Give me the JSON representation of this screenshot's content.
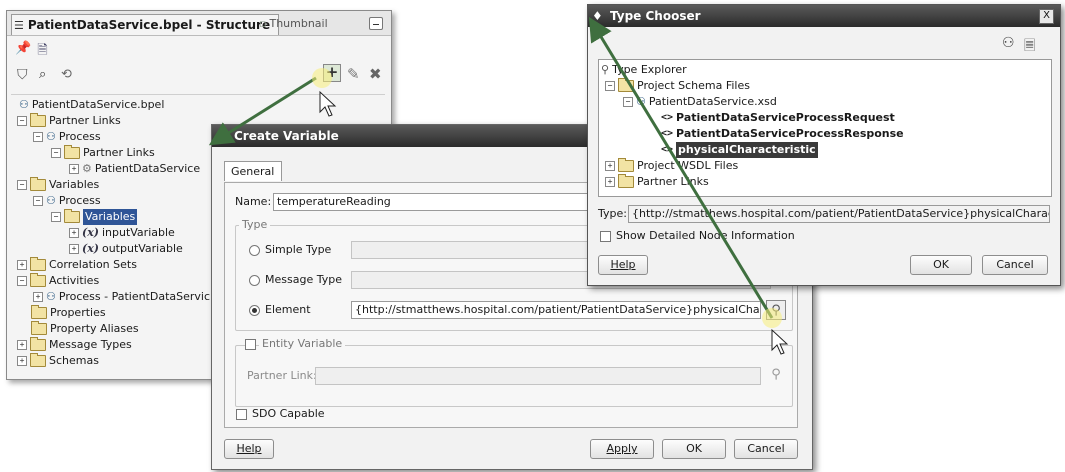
{
  "structure_panel": {
    "tab_active": "PatientDataService.bpel - Structure",
    "tab_inactive": "Thumbnail",
    "tree": [
      {
        "label": "PatientDataService.bpel"
      },
      {
        "label": "Partner Links"
      },
      {
        "label": "Process"
      },
      {
        "label": "Partner Links"
      },
      {
        "label": "PatientDataService"
      },
      {
        "label": "Variables"
      },
      {
        "label": "Process"
      },
      {
        "label": "Variables"
      },
      {
        "label": "inputVariable"
      },
      {
        "label": "outputVariable"
      },
      {
        "label": "Correlation Sets"
      },
      {
        "label": "Activities"
      },
      {
        "label": "Process - PatientDataServic"
      },
      {
        "label": "Properties"
      },
      {
        "label": "Property Aliases"
      },
      {
        "label": "Message Types"
      },
      {
        "label": "Schemas"
      }
    ],
    "var_prefix": "(x)"
  },
  "create_variable": {
    "title": "Create Variable",
    "tab": "General",
    "name_label": "Name:",
    "name_value": "temperatureReading",
    "type_group": "Type",
    "simple_type": "Simple Type",
    "message_type": "Message Type",
    "element": "Element",
    "element_value": "{http://stmatthews.hospital.com/patient/PatientDataService}physicalCharacteristic",
    "entity_variable": "Entity Variable",
    "partner_link_label": "Partner Link:",
    "sdo_capable": "SDO Capable",
    "help": "Help",
    "apply": "Apply",
    "ok": "OK",
    "cancel": "Cancel"
  },
  "type_chooser": {
    "title": "Type Chooser",
    "close": "X",
    "tree": [
      {
        "label": "Type Explorer"
      },
      {
        "label": "Project Schema Files"
      },
      {
        "label": "PatientDataService.xsd"
      },
      {
        "label": "PatientDataServiceProcessRequest"
      },
      {
        "label": "PatientDataServiceProcessResponse"
      },
      {
        "label": "physicalCharacteristic"
      },
      {
        "label": "Project WSDL Files"
      },
      {
        "label": "Partner Links"
      }
    ],
    "type_label": "Type:",
    "type_value": "{http://stmatthews.hospital.com/patient/PatientDataService}physicalCharacteristic",
    "show_detailed": "Show Detailed Node Information",
    "help": "Help",
    "ok": "OK",
    "cancel": "Cancel"
  },
  "colors": {
    "selection": "#2f5597",
    "annotation_arrow": "#3f6f3f"
  }
}
